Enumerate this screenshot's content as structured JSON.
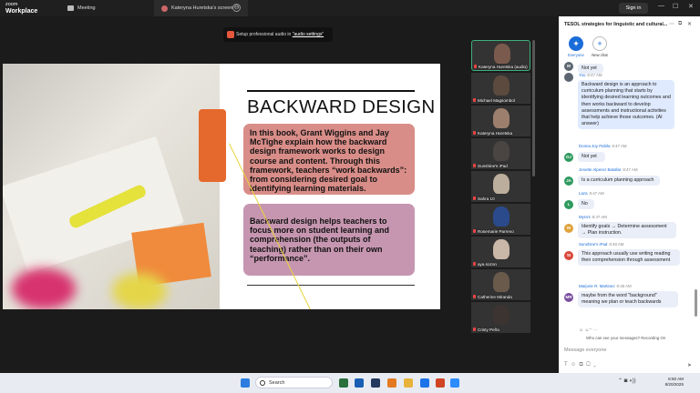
{
  "app": {
    "name_top": "zoom",
    "name_bottom": "Workplace"
  },
  "tabs": [
    {
      "label": "Meeting"
    },
    {
      "label": "Kateryna Huretska's screen"
    }
  ],
  "titlebar": {
    "signin": "Sign in",
    "min": "—",
    "max": "☐",
    "close": "✕"
  },
  "audio_banner": {
    "text": "Setup professional audio in ",
    "link": "\"audio settings\""
  },
  "slide": {
    "title": "BACKWARD DESIGN",
    "box1": "In this book, Grant Wiggins and Jay McTighe explain how the backward design framework works to design course and content. Through this framework, teachers “work backwards”: from considering desired goal to identifying learning materials.",
    "box2": "Backward design helps teachers to focus more on student learning and comprehension (the outputs of teaching) rather than on their own “performance”."
  },
  "gallery": [
    {
      "name": "Kateryna Huretska (audio)",
      "active": true,
      "color": "#7a5a4d"
    },
    {
      "name": "Michael Magsombol",
      "color": "#5c4a3e"
    },
    {
      "name": "Kateryna Huretska",
      "color": "#9c7f6c"
    },
    {
      "name": "Sunshine's iPad",
      "color": "#4a4442"
    },
    {
      "name": "Sahra 10",
      "color": "#bcae9c"
    },
    {
      "name": "Rosemarie Parreno",
      "color": "#2b4a8c"
    },
    {
      "name": "aya sozon",
      "color": "#c9b7a8"
    },
    {
      "name": "Catherine Miranda",
      "color": "#6a5a4c"
    },
    {
      "name": "Cristy Peña",
      "color": "#3b3431"
    }
  ],
  "chat": {
    "title": "TESOL strategies for linguistic and cultural...",
    "header_icons": [
      "⋯",
      "⧉",
      "✕"
    ],
    "tabs": [
      {
        "label": "Everyone",
        "icon": "✦"
      },
      {
        "label": "New chat",
        "icon": "+"
      }
    ],
    "messages": [
      {
        "initials": "M",
        "avatar_color": "#5d6670",
        "bubble": "Not yet",
        "blue": false
      },
      {
        "initials": "",
        "sender": "You",
        "time": "8:47 AM",
        "avatar_color": "#5d6670",
        "bubble": "Backward design is an approach to curriculum planning that starts by identifying desired learning outcomes and then works backward to develop assessments and instructional activities that help achieve those outcomes. (AI answer)",
        "blue": true
      },
      {
        "initials": "DJ",
        "sender": "Donna Joy Pahila",
        "time": "8:47 AM",
        "avatar_color": "#2e9a5e",
        "bubble": "Not yet",
        "blue": false
      },
      {
        "initials": "JA",
        "sender": "Jenette Alperez Batallar",
        "time": "8:47 AM",
        "avatar_color": "#2e9a5e",
        "bubble": "Is a curriculum planning approach",
        "blue": false
      },
      {
        "initials": "L",
        "sender": "Laza",
        "time": "8:47 AM",
        "avatar_color": "#2e9a5e",
        "bubble": "No",
        "blue": false
      },
      {
        "initials": "M",
        "sender": "Myra's",
        "time": "8:47 AM",
        "avatar_color": "#e0a33b",
        "bubble": "Identify goals → Determine assessment → Plan instruction.",
        "blue": false
      },
      {
        "initials": "SI",
        "sender": "Sunshine's iPad",
        "time": "8:48 AM",
        "avatar_color": "#d9483b",
        "bubble": "This approach usually use writing reading then comprehension through assessment",
        "blue": false
      },
      {
        "initials": "MR",
        "sender": "Marjorie R. Martinez",
        "time": "8:48 AM",
        "avatar_color": "#7b4fa0",
        "bubble": "maybe from the word \"background\" meaning we plan or teach backwards",
        "blue": false
      }
    ],
    "who_can_see": "Who can see your messages? Recording On",
    "input_placeholder": "Message everyone"
  },
  "taskbar": {
    "search": "Search",
    "time": "8:50 AM",
    "date": "8/20/2025"
  }
}
